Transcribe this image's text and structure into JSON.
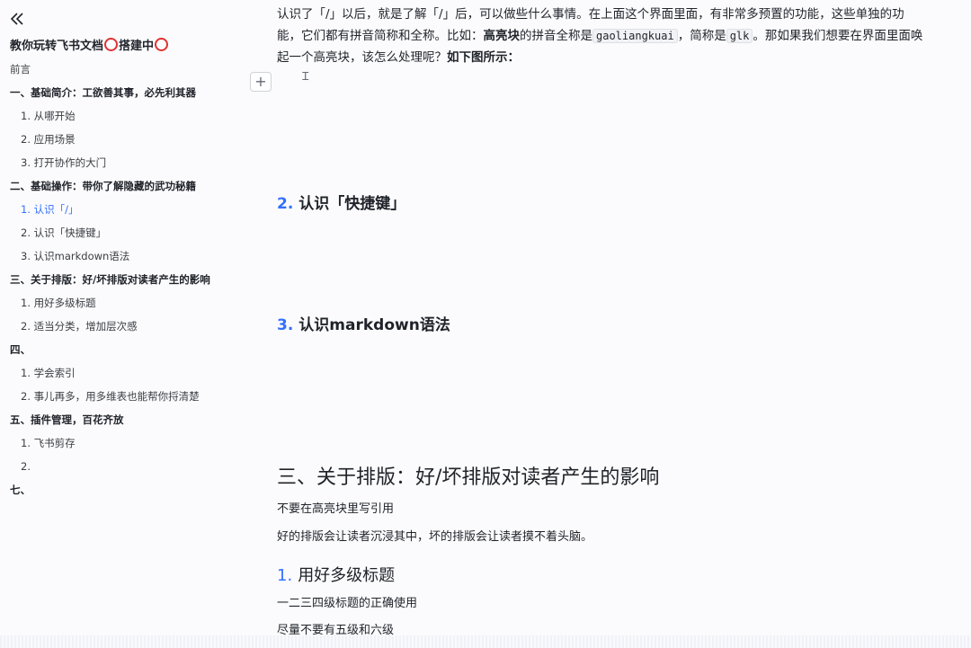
{
  "sidebar": {
    "collapse_icon": "double-chevron-left-icon",
    "title_part1": "教你玩转飞书文档",
    "title_part2": "搭建中",
    "toc": [
      {
        "label": "前言",
        "level": "plain"
      },
      {
        "label": "一、基础简介：工欲善其事，必先利其器",
        "level": "l1"
      },
      {
        "label": "1. 从哪开始",
        "level": "l2"
      },
      {
        "label": "2. 应用场景",
        "level": "l2"
      },
      {
        "label": "3. 打开协作的大门",
        "level": "l2"
      },
      {
        "label": "二、基础操作：带你了解隐藏的武功秘籍",
        "level": "l1"
      },
      {
        "label": "1. 认识「/」",
        "level": "l2",
        "active": true
      },
      {
        "label": "2. 认识「快捷键」",
        "level": "l2"
      },
      {
        "label": "3. 认识markdown语法",
        "level": "l2"
      },
      {
        "label": "三、关于排版：好/坏排版对读者产生的影响",
        "level": "l1"
      },
      {
        "label": "1. 用好多级标题",
        "level": "l2"
      },
      {
        "label": "2. 适当分类，增加层次感",
        "level": "l2"
      },
      {
        "label": "四、",
        "level": "l1"
      },
      {
        "label": "1. 学会索引",
        "level": "l2"
      },
      {
        "label": "2. 事儿再多，用多维表也能帮你捋清楚",
        "level": "l2"
      },
      {
        "label": "五、插件管理，百花齐放",
        "level": "l1"
      },
      {
        "label": "1. 飞书剪存",
        "level": "l2"
      },
      {
        "label": "2.",
        "level": "l2"
      },
      {
        "label": "七、",
        "level": "l1"
      }
    ]
  },
  "content": {
    "intro_a": "认识了「/」以后，就是了解「/」后，可以做些什么事情。在上面这个界面里面，有非常多预置的功能，这些单独的功能，它们都有拼音简称和全称。比如：",
    "intro_bold1": "高亮块",
    "intro_b": "的拼音全称是",
    "code1": "gaoliangkuai",
    "intro_c": "，简称是",
    "code2": "glk",
    "intro_d": "。那如果我们想要在界面里面唤起一个高亮块，该怎么处理呢？",
    "intro_bold2": "如下图所示：",
    "add_label": "+",
    "cursor_glyph": "Ꮖ",
    "h2_shortcut_num": "2.",
    "h2_shortcut": "认识「快捷键」",
    "h2_markdown_num": "3.",
    "h2_markdown": "认识markdown语法",
    "h1_layout": "三、关于排版：好/坏排版对读者产生的影响",
    "line1": "不要在高亮块里写引用",
    "line2": "好的排版会让读者沉浸其中，坏的排版会让读者摸不着头脑。",
    "h2_headings_num": "1.",
    "h2_headings": "用好多级标题",
    "line3": "一二三四级标题的正确使用",
    "line4": "尽量不要有五级和六级"
  }
}
